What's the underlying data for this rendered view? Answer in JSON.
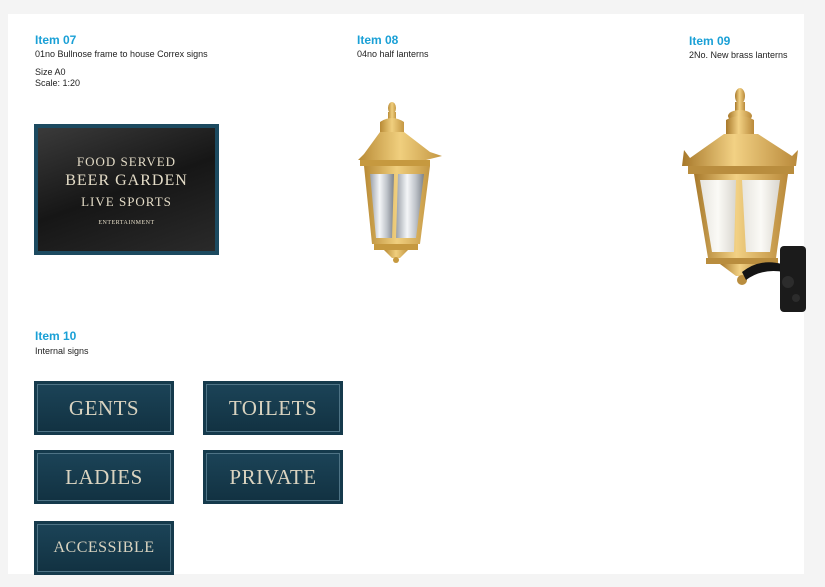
{
  "item07": {
    "title": "Item 07",
    "desc": "01no Bullnose frame to house Correx signs",
    "size": "Size A0",
    "scale": "Scale: 1:20",
    "sign_lines": [
      "FOOD SERVED",
      "BEER GARDEN",
      "LIVE SPORTS",
      "ENTERTAINMENT"
    ]
  },
  "item08": {
    "title": "Item 08",
    "desc": "04no half lanterns"
  },
  "item09": {
    "title": "Item 09",
    "desc": "2No. New brass lanterns"
  },
  "item10": {
    "title": "Item 10",
    "desc": "Internal signs",
    "signs": [
      "GENTS",
      "TOILETS",
      "LADIES",
      "PRIVATE",
      "ACCESSIBLE"
    ]
  },
  "colors": {
    "heading": "#1aa0d6",
    "sign_navy": "#153a4c",
    "brass": "#d4a94e"
  }
}
